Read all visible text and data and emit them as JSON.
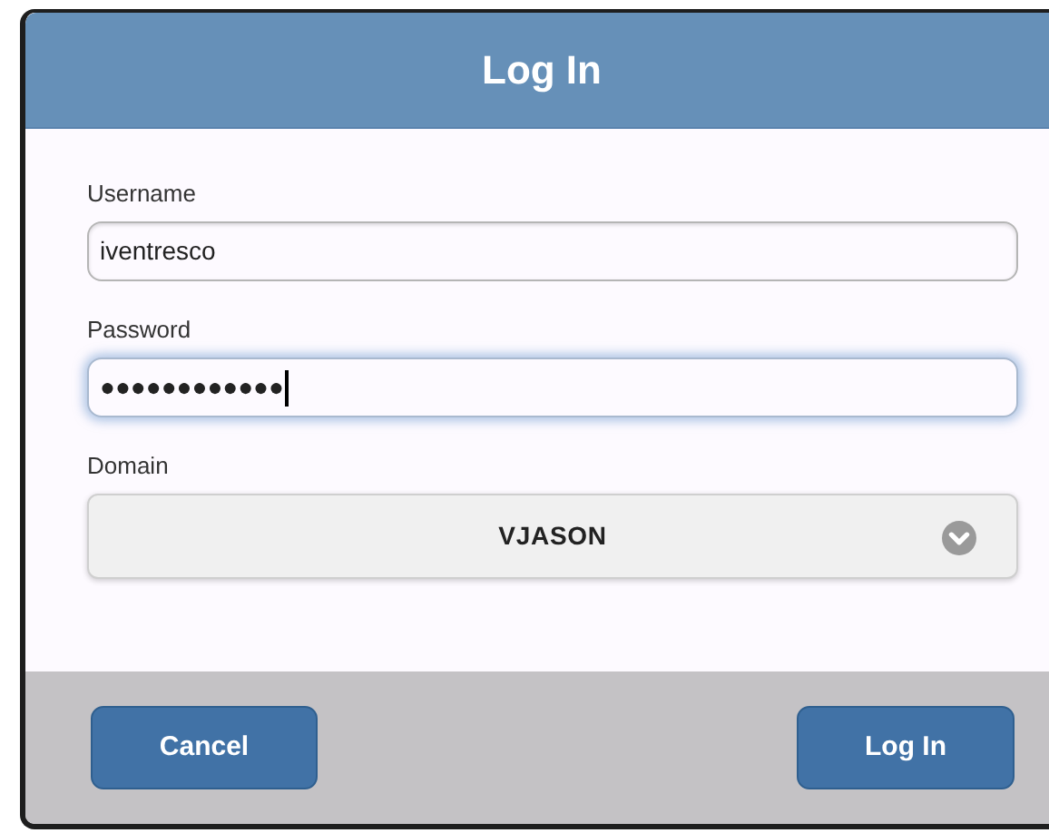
{
  "dialog": {
    "title": "Log In"
  },
  "fields": [
    {
      "kind": "text",
      "label": "Username",
      "value": "iventresco",
      "focused": false
    },
    {
      "kind": "text",
      "label": "Password",
      "value": "●●●●●●●●●●●●",
      "focused": true
    },
    {
      "kind": "select",
      "label": "Domain",
      "value": "VJASON"
    }
  ],
  "buttons": [
    "Cancel",
    "Log In"
  ]
}
